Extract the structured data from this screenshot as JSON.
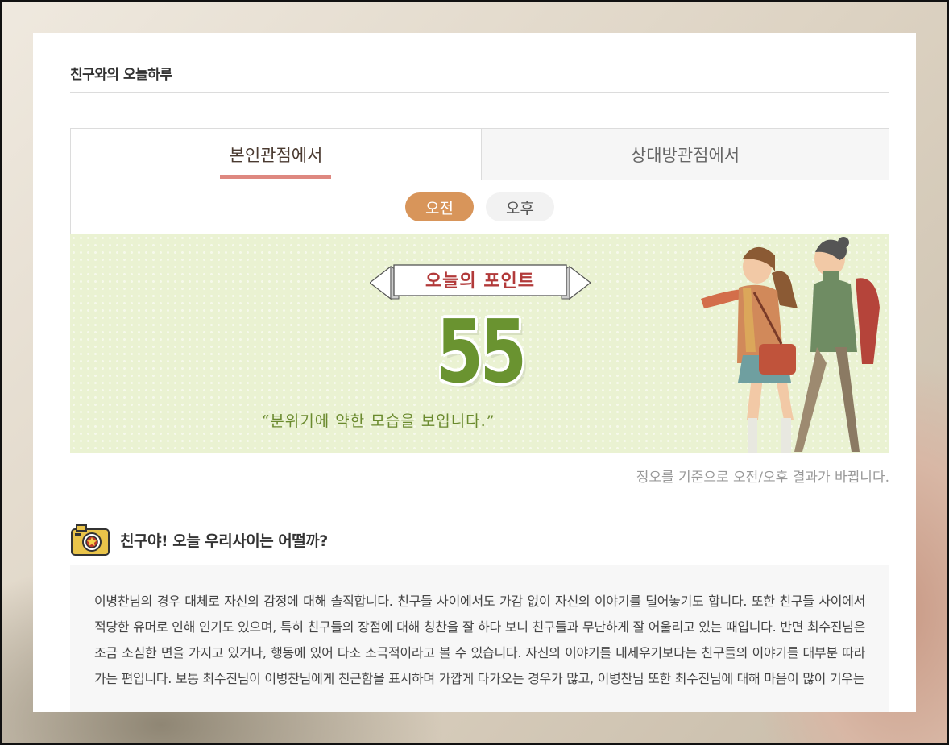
{
  "page": {
    "title": "친구와의 오늘하루"
  },
  "tabs": [
    {
      "label": "본인관점에서",
      "active": true
    },
    {
      "label": "상대방관점에서",
      "active": false
    }
  ],
  "time_toggle": [
    {
      "label": "오전",
      "active": true
    },
    {
      "label": "오후",
      "active": false
    }
  ],
  "banner": {
    "ribbon_text": "오늘의 포인트",
    "score": "55",
    "quote": "“분위기에 약한 모습을 보입니다.”"
  },
  "note": "정오를 기준으로 오전/오후 결과가 바뀝니다.",
  "section": {
    "heading": "친구야! 오늘 우리사이는 어떨까?",
    "body": "이병찬님의 경우 대체로 자신의 감정에 대해 솔직합니다. 친구들 사이에서도 가감 없이 자신의 이야기를 털어놓기도 합니다. 또한 친구들 사이에서 적당한 유머로 인해 인기도 있으며, 특히 친구들의 장점에 대해 칭찬을 잘 하다 보니 친구들과 무난하게 잘 어울리고 있는 때입니다. 반면 최수진님은 조금 소심한 면을 가지고 있거나, 행동에 있어 다소 소극적이라고 볼 수 있습니다. 자신의 이야기를 내세우기보다는 친구들의 이야기를 대부분 따라가는 편입니다. 보통 최수진님이 이병찬님에게 친근함을 표시하며 가깝게 다가오는 경우가 많고, 이병찬님 또한 최수진님에 대해 마음이 많이 기우는"
  },
  "colors": {
    "accent_tab": "#de8880",
    "pill_active": "#d8955a",
    "score_green": "#6a9330",
    "banner_bg": "#eaf2d2",
    "ribbon_text": "#b23a3a"
  },
  "icons": [
    "camera-icon"
  ]
}
